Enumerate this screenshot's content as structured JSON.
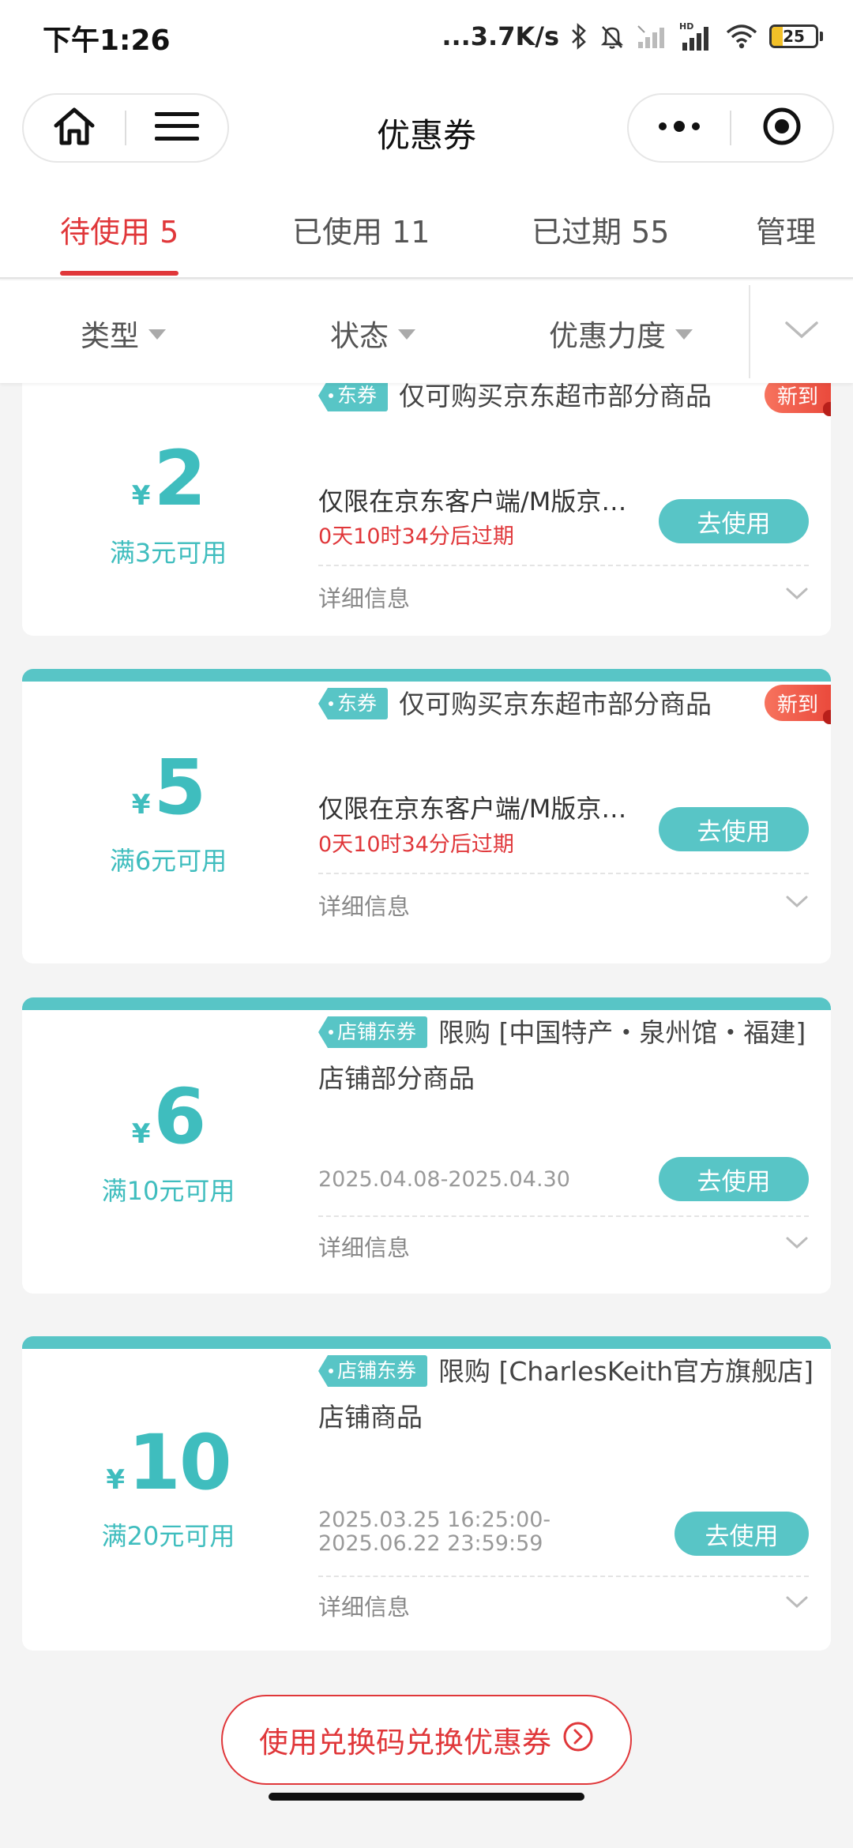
{
  "status_bar": {
    "time": "下午1:26",
    "net_speed": "...3.7K/s",
    "battery": "25",
    "battery_level": 0.25
  },
  "header": {
    "title": "优惠券",
    "home_icon": "home-icon",
    "menu_icon": "hamburger-menu-icon",
    "more_icon": "more-dots-icon",
    "close_icon": "target-close-icon"
  },
  "tabs": [
    {
      "label": "待使用 5",
      "active": true
    },
    {
      "label": "已使用 11",
      "active": false
    },
    {
      "label": "已过期 55",
      "active": false
    },
    {
      "label": "管理",
      "active": false
    }
  ],
  "filters": [
    {
      "label": "类型"
    },
    {
      "label": "状态"
    },
    {
      "label": "优惠力度"
    }
  ],
  "coupons": [
    {
      "yen": "¥",
      "amount": "2",
      "threshold": "满3元可用",
      "tag": "东券",
      "title": "仅可购买京东超市部分商品",
      "desc": "仅限在京东客户端/M版京…",
      "expire": "0天10时34分后过期",
      "use_label": "去使用",
      "detail_label": "详细信息",
      "new_badge": "新到"
    },
    {
      "yen": "¥",
      "amount": "5",
      "threshold": "满6元可用",
      "tag": "东券",
      "title": "仅可购买京东超市部分商品",
      "desc": "仅限在京东客户端/M版京…",
      "expire": "0天10时34分后过期",
      "use_label": "去使用",
      "detail_label": "详细信息",
      "new_badge": "新到"
    },
    {
      "yen": "¥",
      "amount": "6",
      "threshold": "满10元可用",
      "tag": "店铺东券",
      "title": "限购 [中国特产・泉州馆・福建] 店铺部分商品",
      "date_range": "2025.04.08-2025.04.30",
      "use_label": "去使用",
      "detail_label": "详细信息"
    },
    {
      "yen": "¥",
      "amount": "10",
      "threshold": "满20元可用",
      "tag": "店铺东券",
      "title": "限购 [CharlesKeith官方旗舰店] 店铺商品",
      "date_range": "2025.03.25 16:25:00-2025.06.22 23:59:59",
      "use_label": "去使用",
      "detail_label": "详细信息"
    }
  ],
  "redeem_button": {
    "label": "使用兑换码兑换优惠券",
    "icon": "arrow-right-circle-icon"
  },
  "colors": {
    "accent_red": "#e0373a",
    "teal": "#58c5c6",
    "teal_text": "#3fbdbe"
  }
}
